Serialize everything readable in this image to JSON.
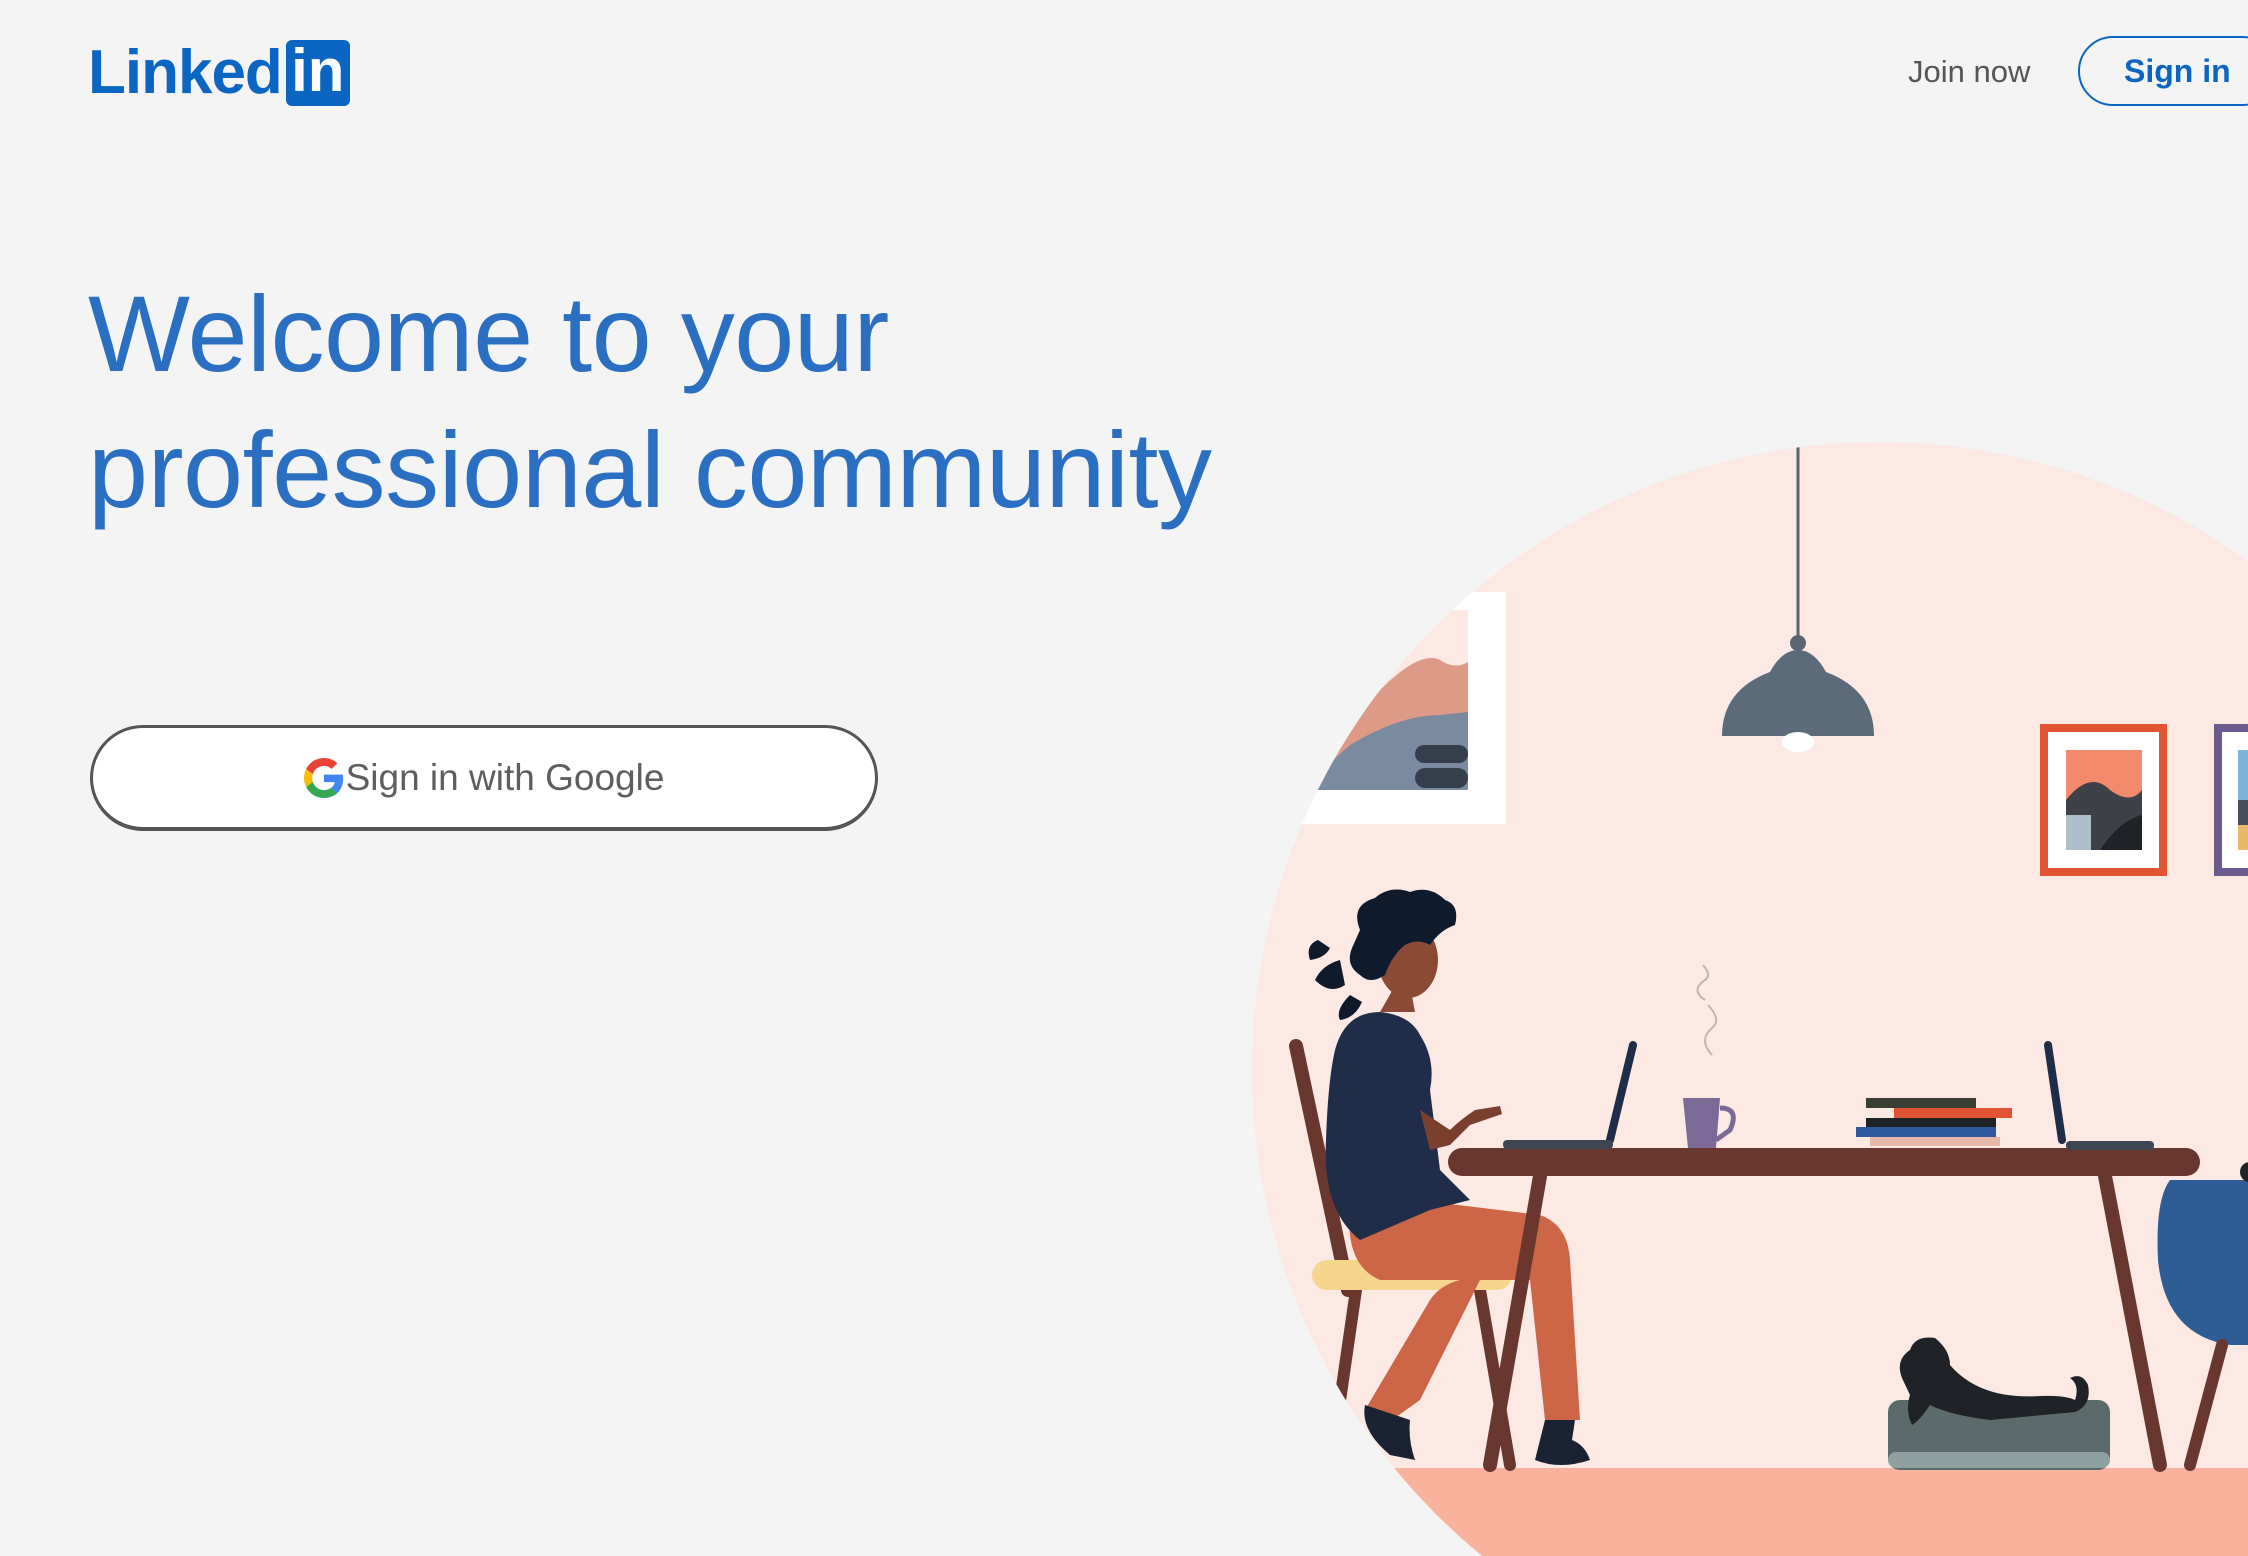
{
  "header": {
    "logo_text": "Linked",
    "logo_box_text": "in",
    "join_now": "Join now",
    "sign_in": "Sign in"
  },
  "hero": {
    "title_line1": "Welcome to your",
    "title_line2": "professional community"
  },
  "google_signin": {
    "label": "Sign in with Google",
    "icon": "google-g-icon"
  },
  "colors": {
    "brand": "#0a66c2",
    "hero_text": "#2b6fc2",
    "background": "#f4f4f4",
    "illustration_bg": "#fde9e4",
    "floor": "#f9b29b"
  }
}
